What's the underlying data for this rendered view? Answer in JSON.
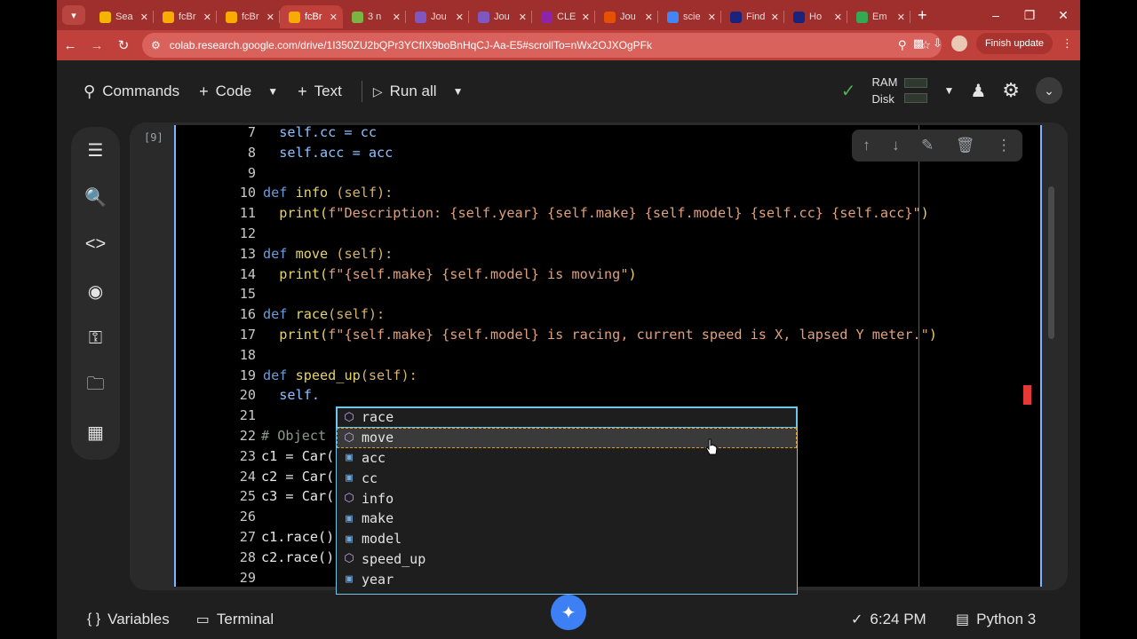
{
  "browser": {
    "tabs": [
      {
        "label": "Sea",
        "icon": "drive-icon",
        "color": "#f4b400"
      },
      {
        "label": "fcBr",
        "icon": "colab-icon",
        "color": "#f9ab00"
      },
      {
        "label": "fcBr",
        "icon": "colab-icon",
        "color": "#f9ab00"
      },
      {
        "label": "fcBr",
        "icon": "colab-icon",
        "color": "#f9ab00",
        "active": true
      },
      {
        "label": "3 n",
        "icon": "doc-icon",
        "color": "#7cb342"
      },
      {
        "label": "Jou",
        "icon": "journal-icon",
        "color": "#7e57c2"
      },
      {
        "label": "Jou",
        "icon": "journal-icon",
        "color": "#7e57c2"
      },
      {
        "label": "CLE",
        "icon": "cle-icon",
        "color": "#8e24aa"
      },
      {
        "label": "Jou",
        "icon": "elsevier-icon",
        "color": "#e65100"
      },
      {
        "label": "scie",
        "icon": "google-icon",
        "color": "#4285f4"
      },
      {
        "label": "Find",
        "icon": "sn-icon",
        "color": "#1a237e"
      },
      {
        "label": "Ho",
        "icon": "sn-icon",
        "color": "#1a237e"
      },
      {
        "label": "Em",
        "icon": "chrome-icon",
        "color": "#34a853"
      }
    ],
    "url": "colab.research.google.com/drive/1I350ZU2bQPr3YCfIX9boBnHqCJ-Aa-E5#scrollTo=nWx2OJXOgPFk",
    "finish_update": "Finish update"
  },
  "toolbar": {
    "commands": "Commands",
    "code": "Code",
    "text": "Text",
    "run_all": "Run all",
    "ram": "RAM",
    "disk": "Disk"
  },
  "cell": {
    "exec_count": "[9]"
  },
  "code_lines": [
    {
      "n": "7"
    },
    {
      "n": "8"
    },
    {
      "n": "9"
    },
    {
      "n": "10"
    },
    {
      "n": "11"
    },
    {
      "n": "12"
    },
    {
      "n": "13"
    },
    {
      "n": "14"
    },
    {
      "n": "15"
    },
    {
      "n": "16"
    },
    {
      "n": "17"
    },
    {
      "n": "18"
    },
    {
      "n": "19"
    },
    {
      "n": "20"
    },
    {
      "n": "21"
    },
    {
      "n": "22"
    },
    {
      "n": "23"
    },
    {
      "n": "24"
    },
    {
      "n": "25"
    },
    {
      "n": "26"
    },
    {
      "n": "27"
    },
    {
      "n": "28"
    },
    {
      "n": "29"
    }
  ],
  "code_text": {
    "l7": "  self.cc = cc",
    "l8": "  self.acc = acc",
    "l10a": "def ",
    "l10b": "info",
    "l10c": " (self):",
    "l11a": "  print(",
    "l11b": "f\"Description: {self.year} {self.make} {self.model} {self.cc} {self.acc}\"",
    "l11c": ")",
    "l13a": "def ",
    "l13b": "move",
    "l13c": " (self):",
    "l14a": "  print(",
    "l14b": "f\"{self.make} {self.model} is moving\"",
    "l14c": ")",
    "l16a": "def ",
    "l16b": "race",
    "l16c": "(self):",
    "l17a": "  print(",
    "l17b": "f\"{self.make} {self.model} is racing, current speed is X, lapsed Y meter.\"",
    "l17c": ")",
    "l19a": "def ",
    "l19b": "speed_up",
    "l19c": "(self):",
    "l20": "  self.",
    "l22": "# Object",
    "l23": "c1 = Car(",
    "l24": "c2 = Car(",
    "l25": "c3 = Car(",
    "l27": "c1.race()",
    "l28": "c2.race()"
  },
  "suggestions": [
    {
      "label": "race",
      "kind": "method",
      "icon": "method-cube-icon",
      "state": "selected"
    },
    {
      "label": "move",
      "kind": "method",
      "icon": "method-cube-icon",
      "state": "hover"
    },
    {
      "label": "acc",
      "kind": "field",
      "icon": "field-icon"
    },
    {
      "label": "cc",
      "kind": "field",
      "icon": "field-icon"
    },
    {
      "label": "info",
      "kind": "method",
      "icon": "method-cube-icon"
    },
    {
      "label": "make",
      "kind": "field",
      "icon": "field-icon"
    },
    {
      "label": "model",
      "kind": "field",
      "icon": "field-icon"
    },
    {
      "label": "speed_up",
      "kind": "method",
      "icon": "method-cube-icon"
    },
    {
      "label": "year",
      "kind": "field",
      "icon": "field-icon"
    }
  ],
  "status_bar": {
    "variables": "Variables",
    "terminal": "Terminal",
    "time": "6:24 PM",
    "runtime": "Python 3"
  },
  "colors": {
    "tab_strip": "#9e2f2c",
    "accent": "#80b4ff",
    "check": "#4caf50"
  }
}
